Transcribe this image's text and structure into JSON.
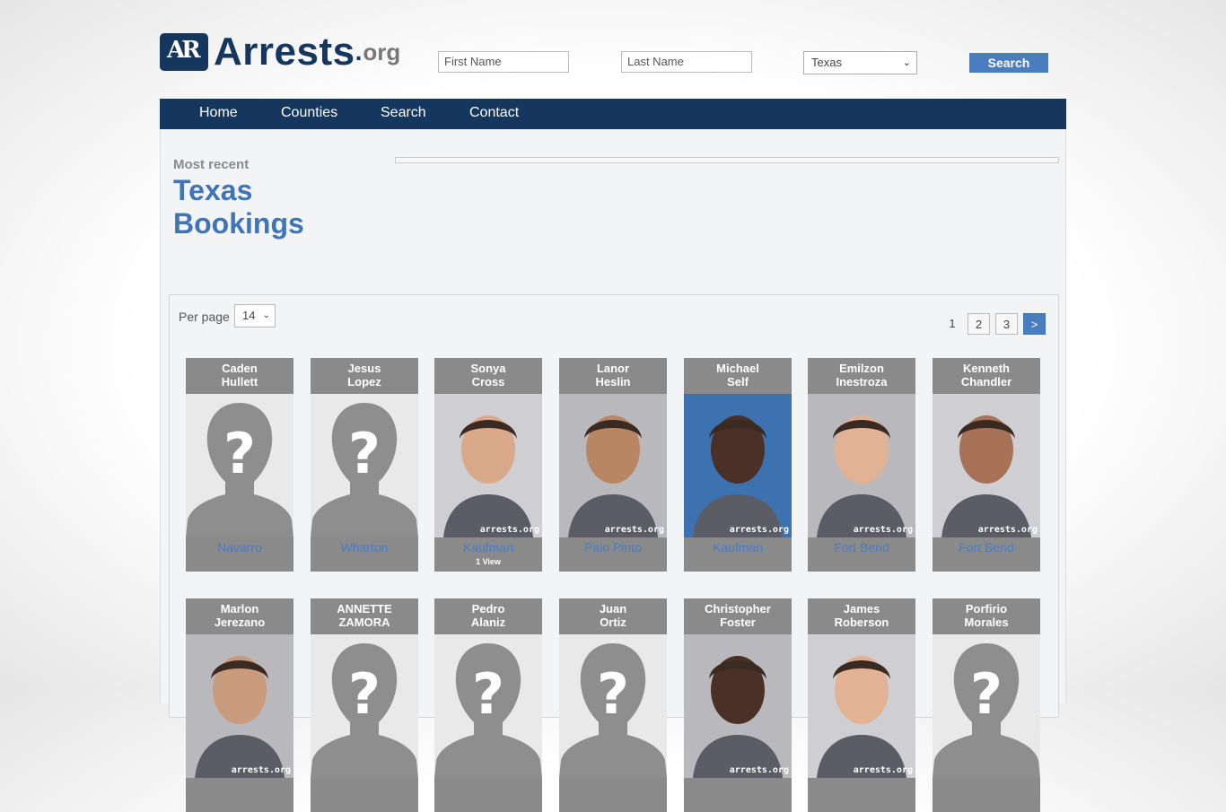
{
  "site": {
    "logo_text": "Arrests",
    "logo_dot": ".",
    "logo_org": "org",
    "logo_mark": "AR"
  },
  "search": {
    "first_placeholder": "First Name",
    "last_placeholder": "Last Name",
    "state": "Texas",
    "button": "Search"
  },
  "nav": [
    "Home",
    "Counties",
    "Search",
    "Contact"
  ],
  "heading": {
    "kicker": "Most recent",
    "line1": "Texas",
    "line2": "Bookings"
  },
  "listing": {
    "per_page_label": "Per page",
    "per_page": "14",
    "pages": [
      "1",
      "2",
      "3",
      ">"
    ]
  },
  "watermark": "arrests.org",
  "inmates": [
    {
      "first": "Caden",
      "last": "Hullett",
      "county": "Navarro",
      "views": "",
      "photo": "placeholder"
    },
    {
      "first": "Jesus",
      "last": "Lopez",
      "county": "Wharton",
      "views": "",
      "photo": "placeholder"
    },
    {
      "first": "Sonya",
      "last": "Cross",
      "county": "Kaufman",
      "views": "1 View",
      "photo": "mugshot"
    },
    {
      "first": "Lanor",
      "last": "Heslin",
      "county": "Palo Pinto",
      "views": "",
      "photo": "mugshot"
    },
    {
      "first": "Michael",
      "last": "Self",
      "county": "Kaufman",
      "views": "",
      "photo": "mugshot"
    },
    {
      "first": "Emilzon",
      "last": "Inestroza",
      "county": "Fort Bend",
      "views": "",
      "photo": "mugshot"
    },
    {
      "first": "Kenneth",
      "last": "Chandler",
      "county": "Fort Bend",
      "views": "",
      "photo": "mugshot"
    },
    {
      "first": "Marlon",
      "last": "Jerezano",
      "county": "",
      "views": "",
      "photo": "mugshot"
    },
    {
      "first": "ANNETTE",
      "last": "ZAMORA",
      "county": "",
      "views": "",
      "photo": "placeholder"
    },
    {
      "first": "Pedro",
      "last": "Alaniz",
      "county": "",
      "views": "",
      "photo": "placeholder"
    },
    {
      "first": "Juan",
      "last": "Ortiz",
      "county": "",
      "views": "",
      "photo": "placeholder"
    },
    {
      "first": "Christopher",
      "last": "Foster",
      "county": "",
      "views": "",
      "photo": "mugshot"
    },
    {
      "first": "James",
      "last": "Roberson",
      "county": "",
      "views": "",
      "photo": "mugshot"
    },
    {
      "first": "Porfirio",
      "last": "Morales",
      "county": "",
      "views": "",
      "photo": "placeholder"
    }
  ]
}
